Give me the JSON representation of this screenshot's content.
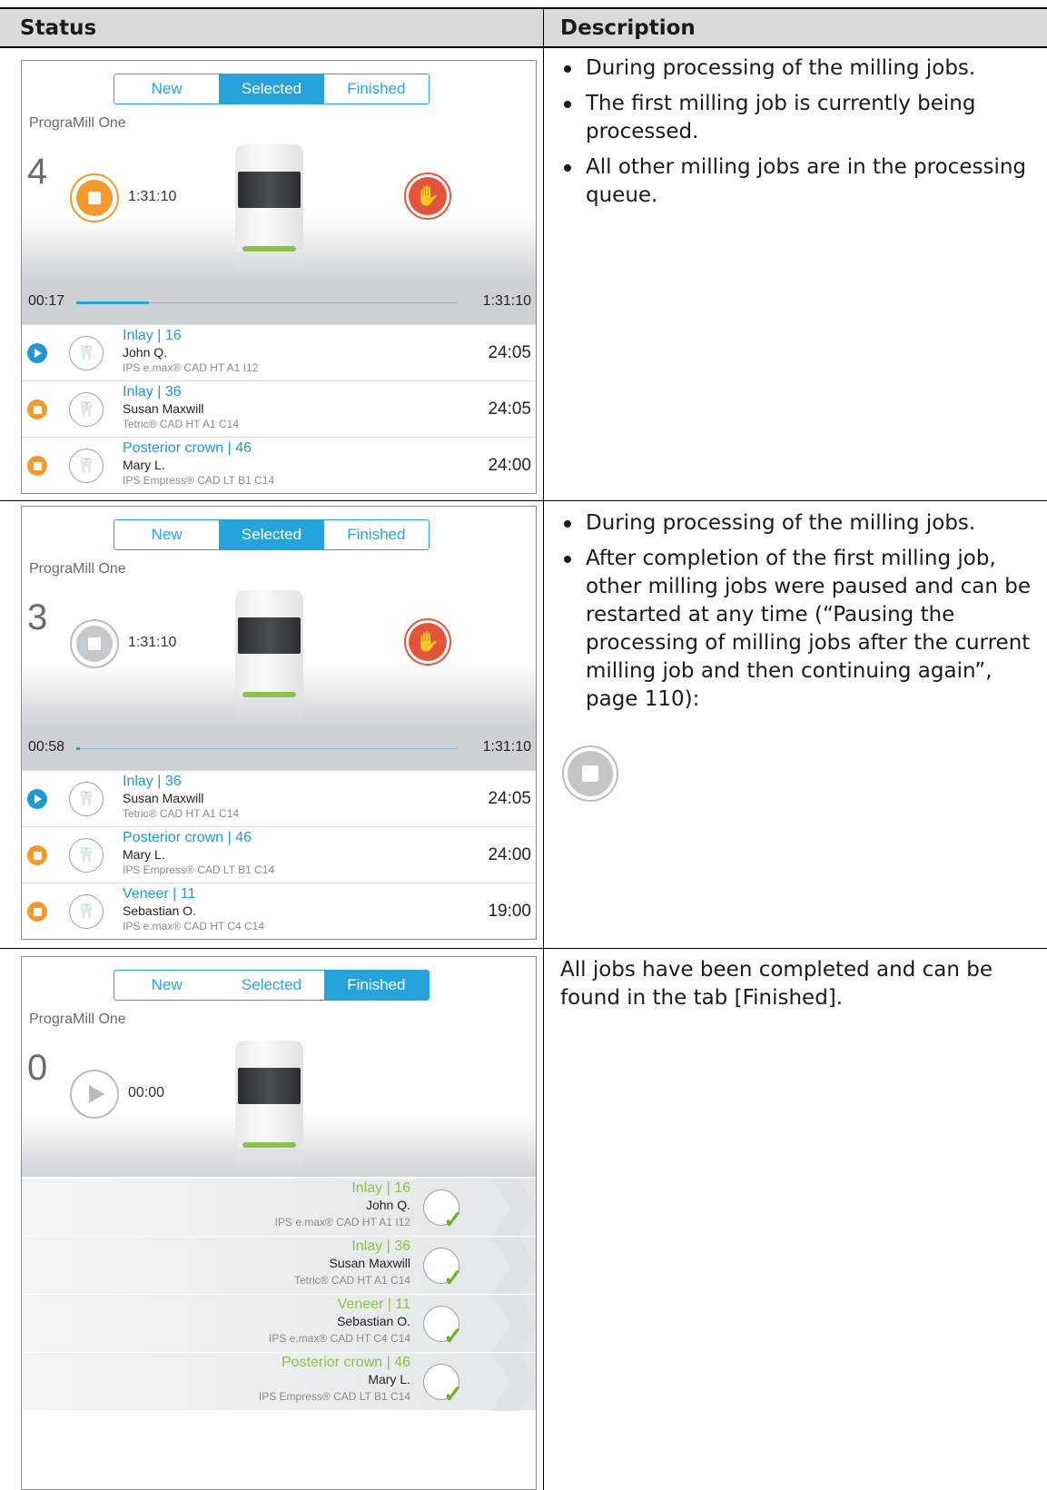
{
  "header": {
    "status": "Status",
    "description": "Description"
  },
  "rows": [
    {
      "panel": {
        "tabs": [
          "New",
          "Selected",
          "Finished"
        ],
        "active_tab": "Selected",
        "machine": "PrograMill One",
        "count": "4",
        "time": "1:31:10",
        "elapsed": "00:17",
        "total": "1:31:10",
        "progress_fraction": 0.19,
        "jobs": [
          {
            "state": "playing",
            "title": "Inlay | 16",
            "patient": "John Q.",
            "material": "IPS e.max® CAD HT A1 I12",
            "duration": "24:05"
          },
          {
            "state": "queued",
            "title": "Inlay | 36",
            "patient": "Susan Maxwill",
            "material": "Tetric® CAD HT A1 C14",
            "duration": "24:05"
          },
          {
            "state": "queued",
            "title": "Posterior crown | 46",
            "patient": "Mary L.",
            "material": "IPS Empress® CAD LT B1 C14",
            "duration": "24:00"
          }
        ]
      },
      "bullets": [
        "During processing of the milling jobs.",
        "The first milling job is currently being processed.",
        "All other milling jobs are in the processing queue."
      ]
    },
    {
      "panel": {
        "tabs": [
          "New",
          "Selected",
          "Finished"
        ],
        "active_tab": "Selected",
        "machine": "PrograMill One",
        "count": "3",
        "time": "1:31:10",
        "elapsed": "00:58",
        "total": "1:31:10",
        "progress_fraction": 0.01,
        "jobs": [
          {
            "state": "playing",
            "title": "Inlay | 36",
            "patient": "Susan Maxwill",
            "material": "Tetric® CAD HT A1 C14",
            "duration": "24:05"
          },
          {
            "state": "queued",
            "title": "Posterior crown | 46",
            "patient": "Mary L.",
            "material": "IPS Empress® CAD LT B1 C14",
            "duration": "24:00"
          },
          {
            "state": "queued",
            "title": "Veneer | 11",
            "patient": "Sebastian O.",
            "material": "IPS e.max® CAD HT C4 C14",
            "duration": "19:00"
          }
        ]
      },
      "bullets": [
        "During processing of the milling jobs.",
        "After completion of the first milling job, other milling jobs were paused and can be restarted at any time (“Pausing the processing of milling jobs after the current milling job and then continuing again”, page 110):"
      ]
    },
    {
      "panel": {
        "tabs": [
          "New",
          "Selected",
          "Finished"
        ],
        "active_tab": "Finished",
        "machine": "PrograMill One",
        "count": "0",
        "time": "00:00",
        "finished_jobs": [
          {
            "title": "Inlay | 16",
            "patient": "John Q.",
            "material": "IPS e.max® CAD HT A1 I12"
          },
          {
            "title": "Inlay | 36",
            "patient": "Susan Maxwill",
            "material": "Tetric® CAD HT A1 C14"
          },
          {
            "title": "Veneer | 11",
            "patient": "Sebastian O.",
            "material": "IPS e.max® CAD HT C4 C14"
          },
          {
            "title": "Posterior crown | 46",
            "patient": "Mary L.",
            "material": "IPS Empress® CAD LT B1 C14"
          }
        ]
      },
      "text": "All jobs have been completed and can be found in the tab [Finished]."
    }
  ]
}
